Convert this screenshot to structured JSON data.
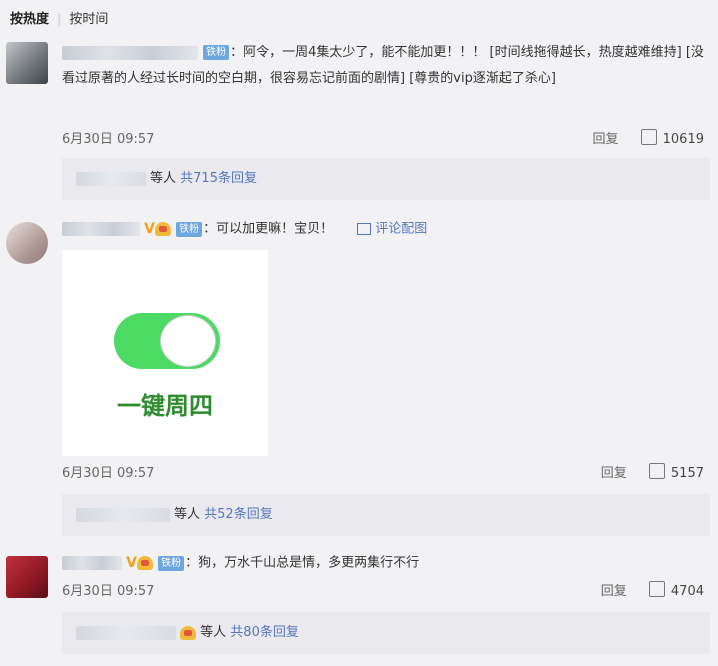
{
  "sort": {
    "hot": "按热度",
    "time": "按时间"
  },
  "comments": [
    {
      "badge": "铁粉",
      "text": "：阿令，一周4集太少了，能不能加更！！！ [时间线拖得越长，热度越难维持] [没看过原著的人经过长时间的空白期，很容易忘记前面的剧情] [尊贵的vip逐渐起了杀心]",
      "date": "6月30日 09:57",
      "reply_label": "回复",
      "likes": "10619",
      "replies_prefix": "等人",
      "replies_count": "共715条回复",
      "avatar_color": "#7f8389"
    },
    {
      "vmark": "V",
      "badge": "铁粉",
      "text": "：可以加更嘛！宝贝！",
      "pic_label": "评论配图",
      "image_text": "一键周四",
      "date": "6月30日 09:57",
      "reply_label": "回复",
      "likes": "5157",
      "replies_prefix": "等人",
      "replies_count": "共52条回复",
      "avatar_color": "#b59c98"
    },
    {
      "vmark": "V",
      "badge": "铁粉",
      "text": "：狗，万水千山总是情，多更两集行不行",
      "date": "6月30日 09:57",
      "reply_label": "回复",
      "likes": "4704",
      "replies_prefix": "等人",
      "replies_count": "共80条回复",
      "avatar_color": "#9a1f2a"
    }
  ]
}
